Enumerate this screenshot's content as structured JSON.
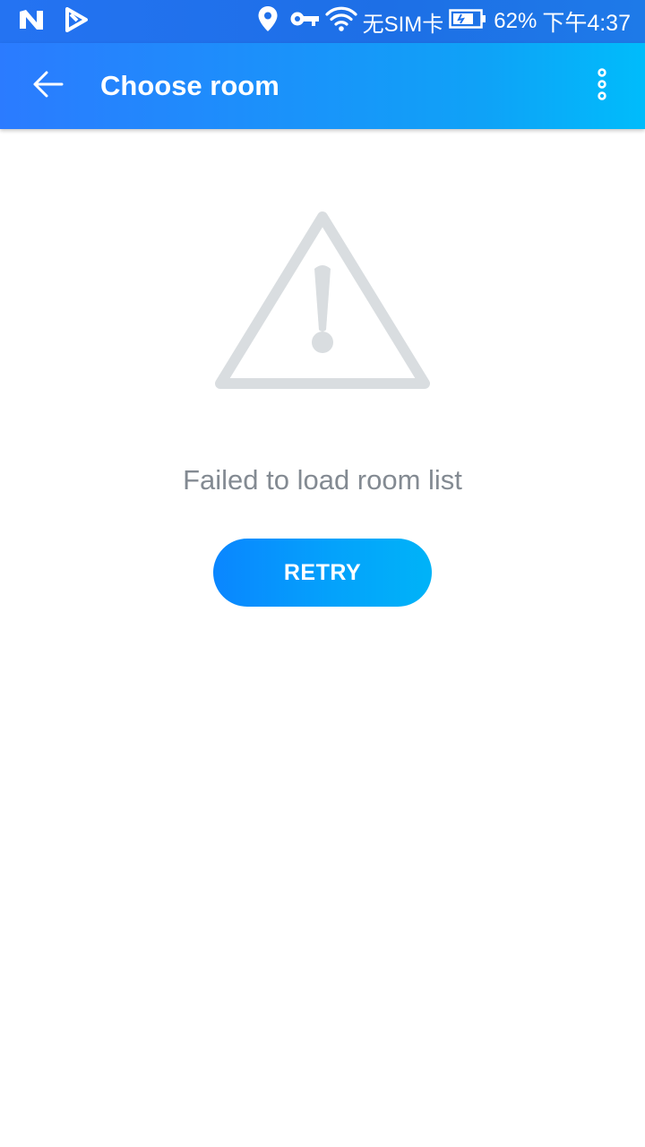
{
  "status_bar": {
    "carrier": "无SIM卡",
    "battery_percent": "62%",
    "time": "下午4:37",
    "icons": [
      "n-notification-icon",
      "play-store-icon",
      "location-icon",
      "vpn-key-icon",
      "wifi-icon",
      "battery-icon"
    ]
  },
  "app_bar": {
    "title": "Choose room",
    "back_icon": "arrow-back-icon",
    "menu_icon": "more-vert-icon"
  },
  "error_state": {
    "icon": "warning-icon",
    "message": "Failed to load room list",
    "retry_label": "RETRY"
  },
  "colors": {
    "app_bar_start": "#2b7bff",
    "app_bar_end": "#00bcfb",
    "button_start": "#0a86ff",
    "button_end": "#00b3f8",
    "icon_gray": "#d9dde0",
    "text_gray": "#838a92"
  }
}
